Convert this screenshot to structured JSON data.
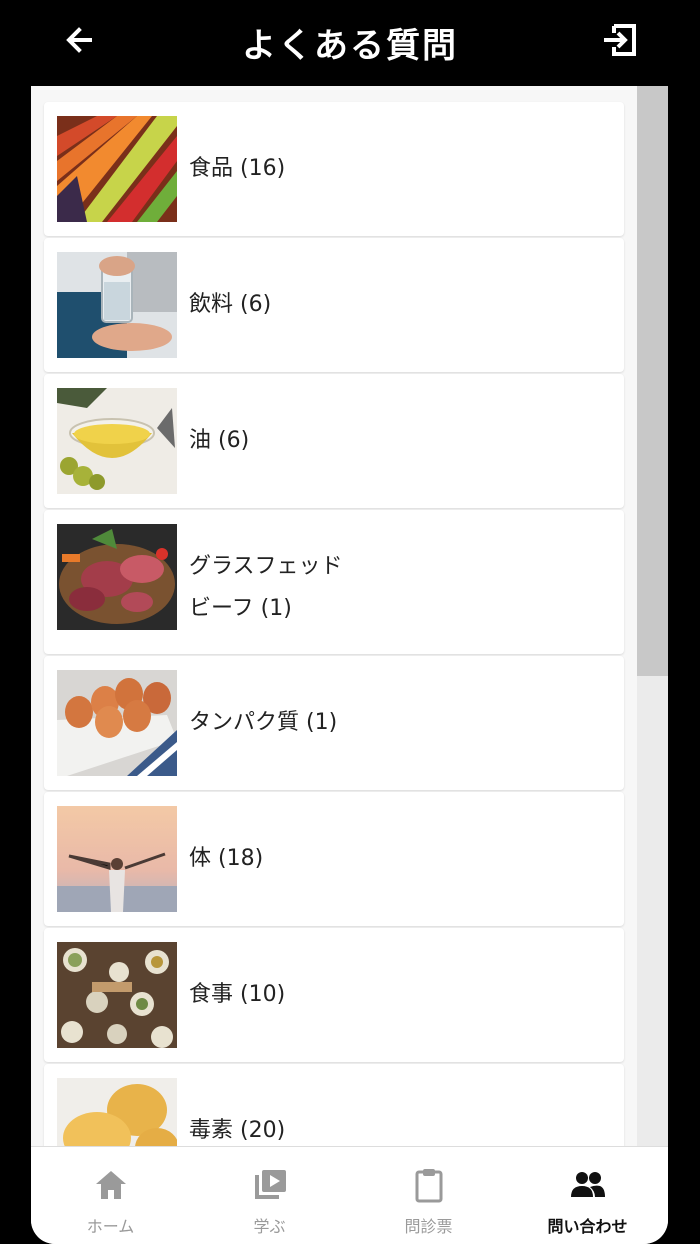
{
  "header": {
    "title": "よくある質問",
    "back_icon": "arrow-left-icon",
    "logout_icon": "logout-icon"
  },
  "categories": [
    {
      "label": "食品 (16)",
      "image": "vegetables"
    },
    {
      "label": "飲料 (6)",
      "image": "glass-of-water"
    },
    {
      "label": "油 (6)",
      "image": "olive-oil"
    },
    {
      "label_line1": "グラスフェッド",
      "label_line2": "ビーフ (1)",
      "image": "raw-meat"
    },
    {
      "label": "タンパク質 (1)",
      "image": "eggs"
    },
    {
      "label": "体 (18)",
      "image": "woman-at-beach"
    },
    {
      "label": "食事 (10)",
      "image": "meal-table"
    },
    {
      "label": "毒素 (20)",
      "image": "bread"
    }
  ],
  "tabs": [
    {
      "label": "ホーム",
      "icon": "home-icon",
      "active": false
    },
    {
      "label": "学ぶ",
      "icon": "play-library-icon",
      "active": false
    },
    {
      "label": "問診票",
      "icon": "clipboard-icon",
      "active": false
    },
    {
      "label": "問い合わせ",
      "icon": "people-icon",
      "active": true
    }
  ],
  "colors": {
    "header_bg": "#000000",
    "active_tab": "#111111",
    "inactive_tab": "#9a9a9a"
  }
}
